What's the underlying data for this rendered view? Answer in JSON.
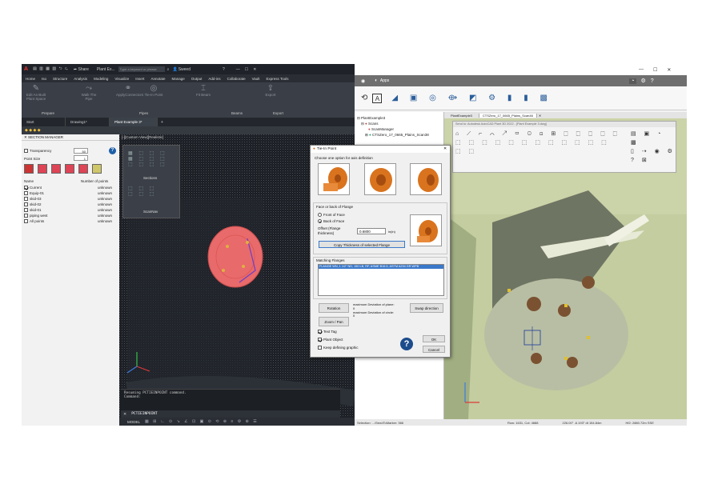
{
  "left_app": {
    "title_bar": {
      "app_logo": "A",
      "share_label": "Share",
      "doc_title": "Plant Ex...",
      "search_placeholder": "Type a keyword or phrase",
      "user_name": "Sweed"
    },
    "ribbon_tabs": [
      "Home",
      "Iso",
      "Structure",
      "Analysis",
      "Modeling",
      "Visualize",
      "Insert",
      "Annotate",
      "Manage",
      "Output",
      "Add-ins",
      "Collaborate",
      "Vault",
      "Express Tools"
    ],
    "ribbon_buttons": [
      "Edit As-Built Plant Space",
      "Walk The Pipe",
      "ApplyConnectors",
      "Tie-In Point",
      "Fit Beam",
      "Export"
    ],
    "ribbon_groups": [
      "Prepare",
      "Pipes",
      "Beams",
      "Export"
    ],
    "doc_tabs": [
      "Start",
      "Drawing1*",
      "Plant Example 3*"
    ],
    "section_manager": {
      "title": "SECTION MANAGER",
      "transparency_label": "Transparency",
      "transparency_value": "50",
      "point_size_label": "Point Size",
      "point_size_value": "1",
      "col_name": "Name",
      "col_points": "Number of points",
      "items": [
        {
          "name": "Current",
          "points": "unknown",
          "checked": true
        },
        {
          "name": "Equip-01",
          "points": "unknown",
          "checked": false
        },
        {
          "name": "skid-03",
          "points": "unknown",
          "checked": false
        },
        {
          "name": "skid-02",
          "points": "unknown",
          "checked": false
        },
        {
          "name": "skid-01",
          "points": "unknown",
          "checked": false
        },
        {
          "name": "piping west",
          "points": "unknown",
          "checked": false
        },
        {
          "name": "All points",
          "points": "unknown",
          "checked": false
        }
      ]
    },
    "viewport": {
      "label": "[-][Custom View][Realistic]",
      "sections_label": "Sections",
      "scannav_label": "ScanNav"
    },
    "command_line": {
      "history": "Resuming PCTIEINPOINT command.",
      "prompt": "Command:",
      "current": "PCTIEINPOINT"
    },
    "status": {
      "model_label": "MODEL"
    }
  },
  "dialog": {
    "title": "Tie-In Point",
    "choose_label": "Choose one option for axis definition",
    "face_group": "Face or back of Flange",
    "front_label": "Front of Face",
    "back_label": "Back of Face",
    "offset_label": "Offset (Flange thickness)",
    "offset_value": "0.6800",
    "offset_unit": "in(in)",
    "copy_btn": "Copy Thickness of selected Flange",
    "matching_label": "Matching Flanges",
    "matching_item": "FLANGE WN, 1 1/2\" ND, 150 LB, RF, ASME B16.5, ASTM A234 GR WPB",
    "rotation_btn": "Rotation",
    "zoom_btn": "Zoom / Pan",
    "dev_plane_label": "maximum Deviation of plane:",
    "dev_plane_value": "0",
    "dev_circle_label": "maximum Deviation of circle:",
    "dev_circle_value": "0",
    "swap_btn": "Swap direction",
    "text_tag_label": "Text Tag",
    "plant_object_label": "Plant Object",
    "keep_graphic_label": "Keep defining graphic",
    "ok_btn": "OK",
    "cancel_btn": "Cancel"
  },
  "right_app": {
    "apps_label": "Apps",
    "tree": {
      "root": "PlantExample3",
      "scans": "Scans",
      "scan_manager": "ScanManager",
      "scan_item": "CTSZero_17_0665_Plains_Scan38"
    },
    "tabs": [
      "PlantExample3",
      "CTSZero_17_0665_Plains_Scan46"
    ],
    "send_toolbar_title": "Send to: Autodesk AutoCAD Plant 3D 2022 - [Plant Example 3.dwg]",
    "status": {
      "selection": "Selection: .../SendToMarker: 366",
      "row_col": "Row: 1631, Col: 4688",
      "angles": "226.00° -6.193° dt 154.84m",
      "hfov": "Hf2: 2880.72m SSE"
    }
  },
  "colors": {
    "flange_orange": "#d9731e",
    "dialog_highlight": "#3a78c9",
    "flange_pink": "#e86a6a"
  }
}
